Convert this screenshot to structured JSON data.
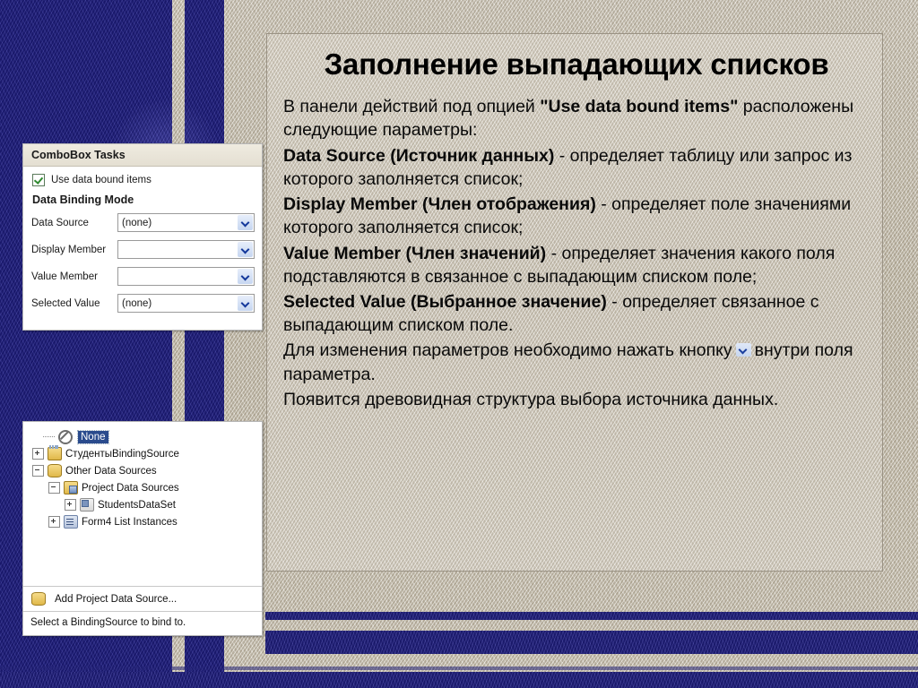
{
  "slide": {
    "title": "Заполнение выпадающих списков"
  },
  "body": {
    "p1_prefix": "В панели действий под опцией ",
    "p1_bold": "\"Use data bound items\"",
    "p1_suffix": " расположены следующие параметры:",
    "p2_bold": "Data Source (Источник данных)",
    "p2_text": " - определяет таблицу или запрос из которого заполняется список;",
    "p3_bold": "Display Member (Член отображения)",
    "p3_text": " - определяет поле значениями которого заполняется список;",
    "p4_bold": "Value Member (Член значений)",
    "p4_text": " - определяет значения какого поля подставляются в связанное с выпадающим списком поле;",
    "p5_bold": "Selected Value (Выбранное значение)",
    "p5_text": " - определяет связанное с выпадающим списком поле.",
    "p6_prefix": "Для изменения параметров необходимо нажать кнопку",
    "p6_suffix": "внутри поля параметра.",
    "p7": "Появится древовидная структура выбора источника данных."
  },
  "combobox_tasks": {
    "header": "ComboBox Tasks",
    "use_data_bound_items": "Use data bound items",
    "data_binding_mode": "Data Binding Mode",
    "fields": [
      {
        "label": "Data Source",
        "value": "(none)"
      },
      {
        "label": "Display Member",
        "value": ""
      },
      {
        "label": "Value Member",
        "value": ""
      },
      {
        "label": "Selected Value",
        "value": "(none)"
      }
    ]
  },
  "datasource_tree": {
    "nodes": [
      {
        "label": "None",
        "icon": "none-icon",
        "expander": "none",
        "indent": 0,
        "selected": true
      },
      {
        "label": "СтудентыBindingSource",
        "icon": "binding-source-icon",
        "expander": "plus",
        "indent": 0,
        "selected": false
      },
      {
        "label": "Other Data Sources",
        "icon": "data-source-icon",
        "expander": "minus",
        "indent": 0,
        "selected": false
      },
      {
        "label": "Project Data Sources",
        "icon": "project-sources-icon",
        "expander": "minus",
        "indent": 1,
        "selected": false
      },
      {
        "label": "StudentsDataSet",
        "icon": "dataset-icon",
        "expander": "plus",
        "indent": 2,
        "selected": false
      },
      {
        "label": "Form4 List Instances",
        "icon": "list-instances-icon",
        "expander": "plus",
        "indent": 1,
        "selected": false
      }
    ],
    "add_link": "Add Project Data Source...",
    "status": "Select a BindingSource to bind to."
  },
  "colors": {
    "background_blue": "#201f87",
    "paper_beige": "#d5cec0",
    "panel_beige": "#dbd5c8",
    "selection_blue": "#2a4b8d",
    "chevron_blue": "#14389b",
    "check_green": "#2f8a2f"
  }
}
